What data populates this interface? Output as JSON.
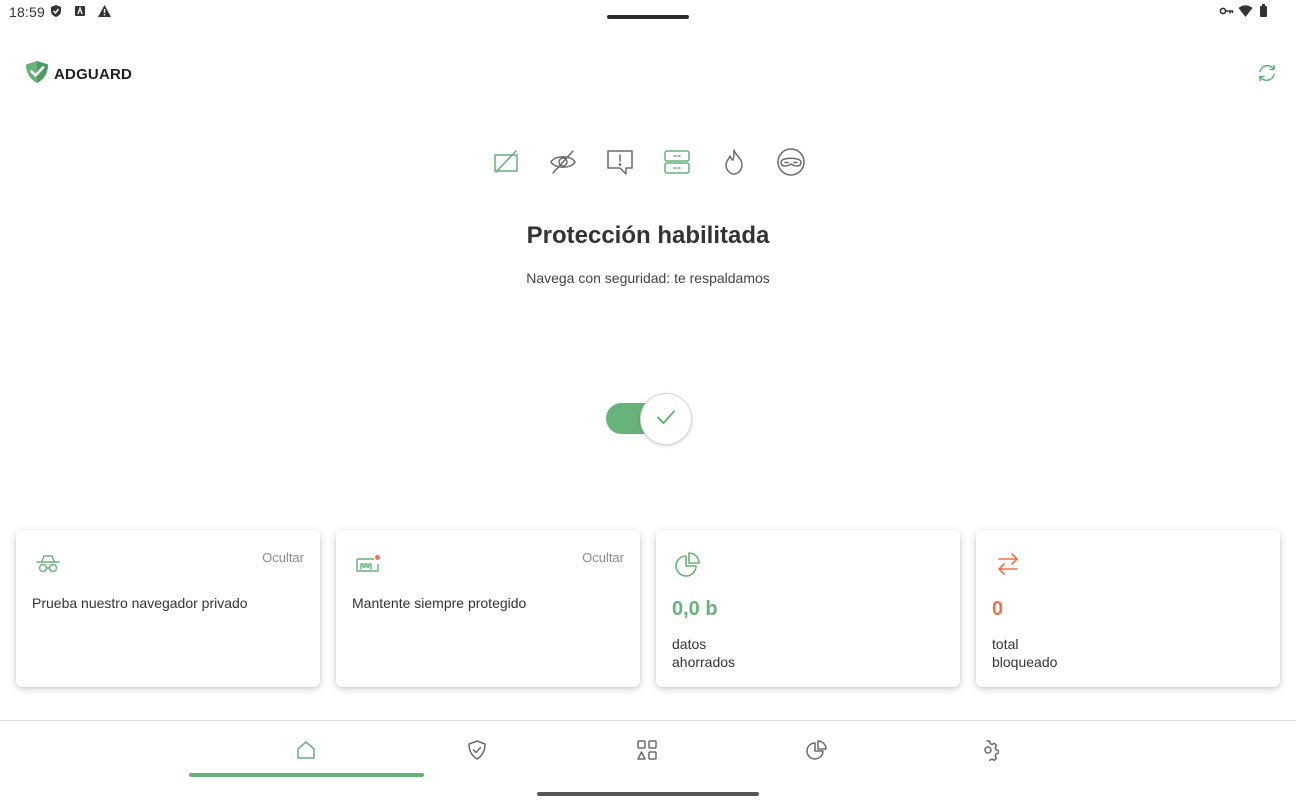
{
  "status_bar": {
    "time": "18:59",
    "left_icons": [
      "adguard-shield-icon",
      "a-box-icon",
      "warning-icon"
    ],
    "right_icons": [
      "vpn-key-icon",
      "wifi-icon",
      "battery-icon"
    ]
  },
  "header": {
    "logo_text": "ADGUARD",
    "refresh_icon": "refresh-icon"
  },
  "features": [
    {
      "name": "ads-blocked-icon",
      "active": true
    },
    {
      "name": "tracking-eye-icon",
      "active": false
    },
    {
      "name": "annoyance-chat-icon",
      "active": false
    },
    {
      "name": "dns-server-icon",
      "active": true
    },
    {
      "name": "firewall-flame-icon",
      "active": false
    },
    {
      "name": "stealth-mask-icon",
      "active": false
    }
  ],
  "status": {
    "title": "Protección habilitada",
    "subtitle": "Navega con seguridad: te respaldamos"
  },
  "toggle": {
    "state": "on"
  },
  "cards": [
    {
      "icon": "incognito-icon",
      "hide": "Ocultar",
      "text": "Prueba nuestro navegador privado"
    },
    {
      "icon": "license-ticket-icon",
      "hide": "Ocultar",
      "text": "Mantente siempre protegido"
    },
    {
      "icon": "pie-chart-icon",
      "value": "0,0 b",
      "label_1": "datos",
      "label_2": "ahorrados"
    },
    {
      "icon": "transfer-arrows-icon",
      "value": "0",
      "label_1": "total",
      "label_2": "bloqueado"
    }
  ],
  "nav": {
    "items": [
      "home-icon",
      "protection-shield-icon",
      "apps-icon",
      "statistics-icon",
      "settings-gear-icon"
    ],
    "active": "home-icon"
  },
  "colors": {
    "accent_green": "#67b279",
    "accent_orange": "#f0704c",
    "icon_gray": "#6b6b6b"
  }
}
